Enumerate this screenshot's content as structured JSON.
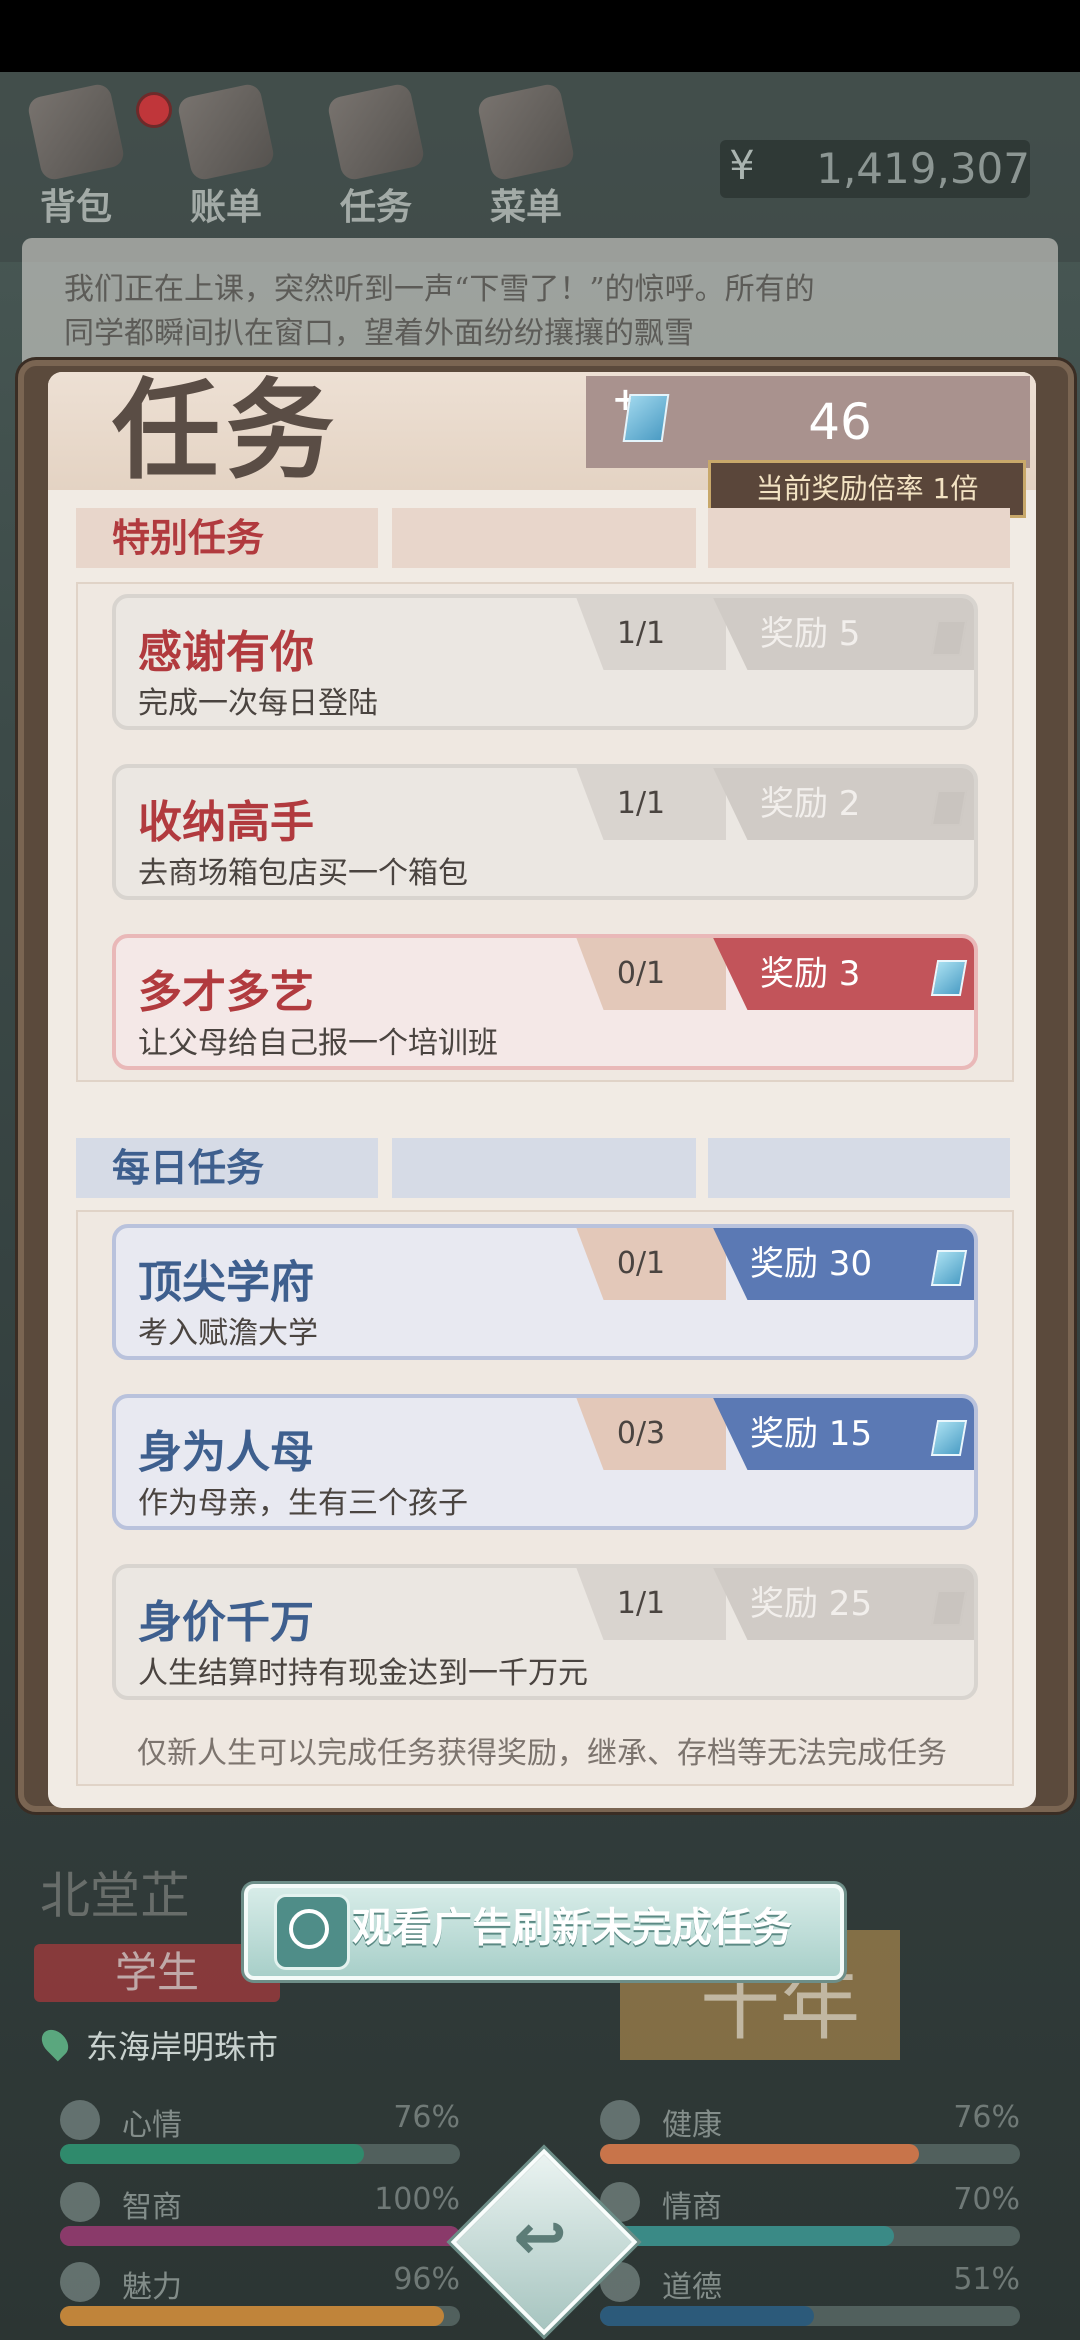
{
  "nav": {
    "items": [
      {
        "label": "背包",
        "icon": "backpack-icon"
      },
      {
        "label": "账单",
        "icon": "bill-icon"
      },
      {
        "label": "任务",
        "icon": "task-icon"
      },
      {
        "label": "菜单",
        "icon": "menu-icon"
      }
    ],
    "money_symbol": "¥",
    "money": "1,419,307"
  },
  "story": {
    "line1": "我们正在上课，突然听到一声“下雪了！”的惊呼。所有的",
    "line2": "同学都瞬间扒在窗口，望着外面纷纷攘攘的飘雪"
  },
  "panel": {
    "title": "任务",
    "gems": "46",
    "plus": "+",
    "multiplier": "当前奖励倍率 1倍",
    "special_label": "特别任务",
    "daily_label": "每日任务",
    "footnote": "仅新人生可以完成任务获得奖励，继承、存档等无法完成任务"
  },
  "special_tasks": [
    {
      "name": "感谢有你",
      "desc": "完成一次每日登陆",
      "progress": "1/1",
      "reward": "奖励 5",
      "state": "done"
    },
    {
      "name": "收纳高手",
      "desc": "去商场箱包店买一个箱包",
      "progress": "1/1",
      "reward": "奖励 2",
      "state": "done"
    },
    {
      "name": "多才多艺",
      "desc": "让父母给自己报一个培训班",
      "progress": "0/1",
      "reward": "奖励 3",
      "state": "active"
    }
  ],
  "daily_tasks": [
    {
      "name": "顶尖学府",
      "desc": "考入赋澹大学",
      "progress": "0/1",
      "reward": "奖励 30",
      "state": "active"
    },
    {
      "name": "身为人母",
      "desc": "作为母亲，生有三个孩子",
      "progress": "0/3",
      "reward": "奖励 15",
      "state": "active"
    },
    {
      "name": "身价千万",
      "desc": "人生结算时持有现金达到一千万元",
      "progress": "1/1",
      "reward": "奖励 25",
      "state": "done"
    }
  ],
  "bottom": {
    "ad_button": "观看广告刷新未完成任务",
    "character_name": "北堂芷",
    "role": "学生",
    "city": "东海岸明珠市",
    "age": "十年",
    "back_glyph": "↩"
  },
  "stats": [
    {
      "label": "心情",
      "value": "76%",
      "fill": 0.76,
      "color": "#2f8a6c"
    },
    {
      "label": "健康",
      "value": "76%",
      "fill": 0.76,
      "color": "#c8744a"
    },
    {
      "label": "智商",
      "value": "100%",
      "fill": 1.0,
      "color": "#8a3a6a"
    },
    {
      "label": "情商",
      "value": "70%",
      "fill": 0.7,
      "color": "#3a8a86"
    },
    {
      "label": "魅力",
      "value": "96%",
      "fill": 0.96,
      "color": "#c0843a"
    },
    {
      "label": "道德",
      "value": "51%",
      "fill": 0.51,
      "color": "#2c5a7a"
    }
  ],
  "colors": {
    "special_accent": "#b13a3e",
    "daily_accent": "#3e5f8e",
    "reward_done": "#d0cbc6",
    "reward_special": "#c2545a",
    "reward_daily": "#5b79b4"
  }
}
